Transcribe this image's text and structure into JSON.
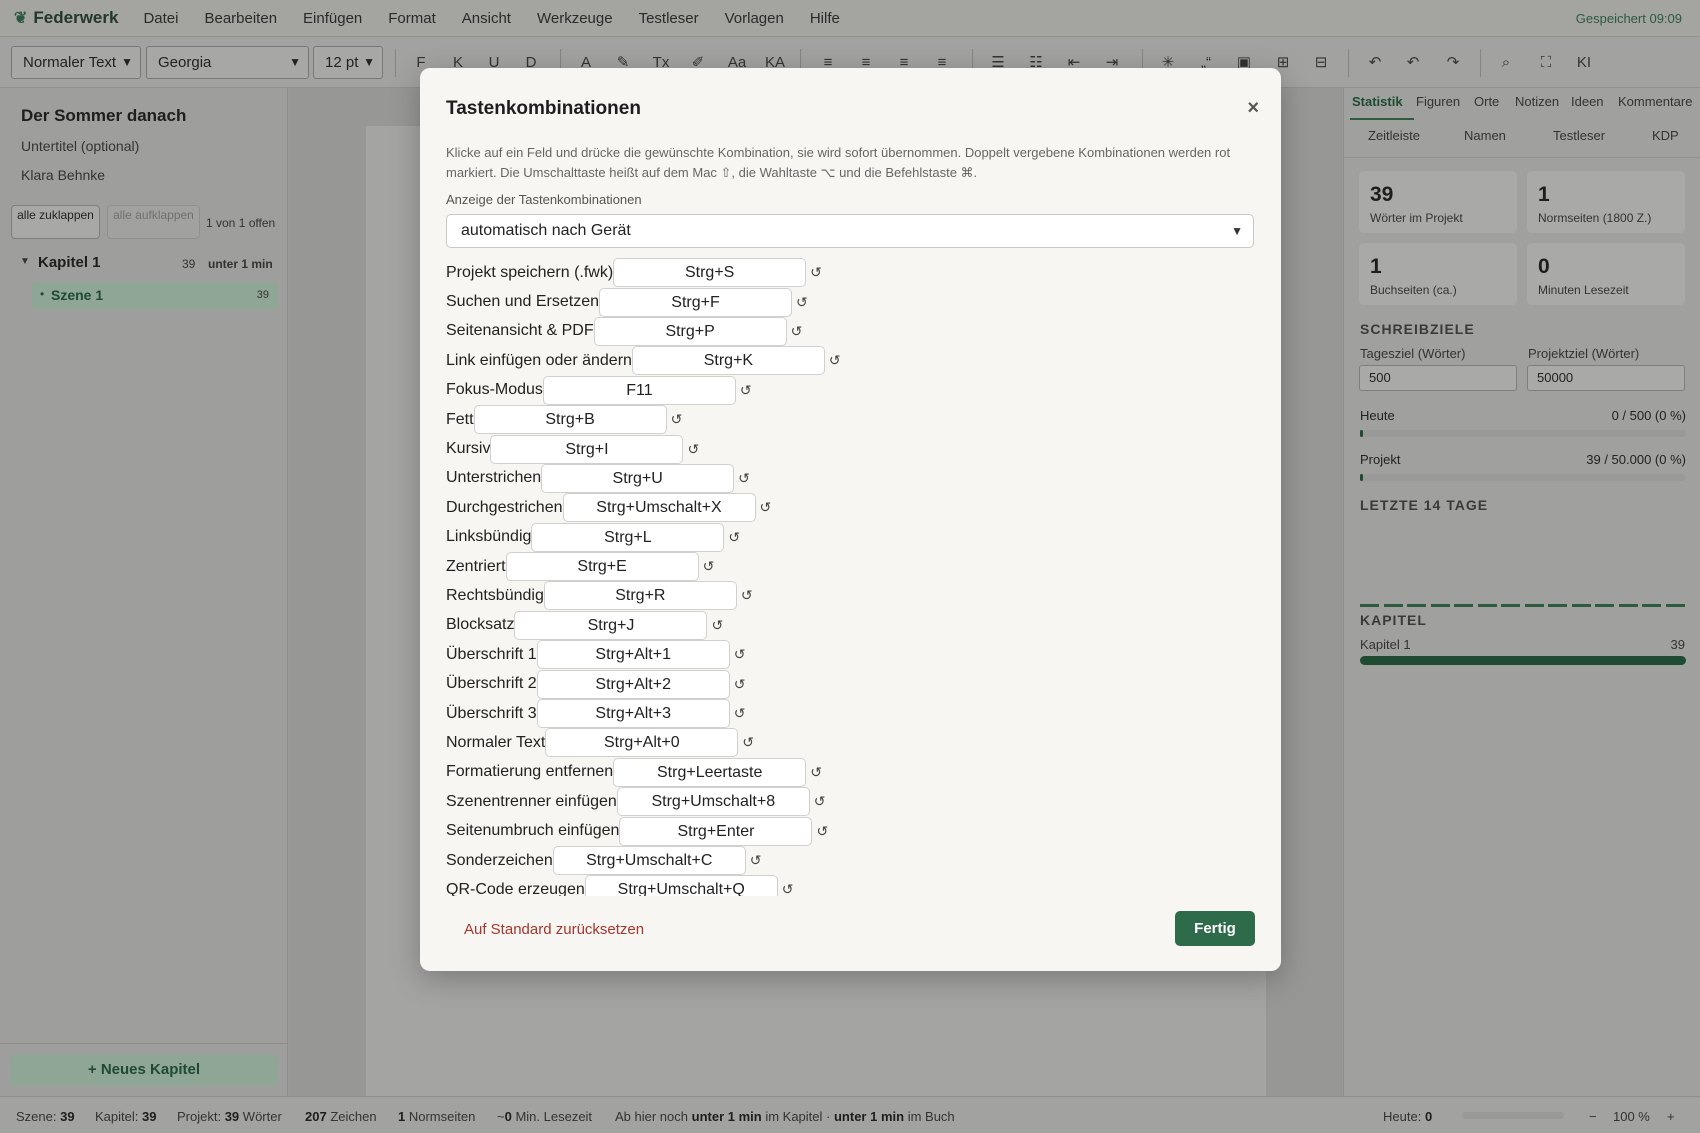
{
  "app": {
    "name": "Federwerk",
    "saved": "Gespeichert 09:09"
  },
  "menu": [
    "Datei",
    "Bearbeiten",
    "Einfügen",
    "Format",
    "Ansicht",
    "Werkzeuge",
    "Testleser",
    "Vorlagen",
    "Hilfe"
  ],
  "toolbar": {
    "style": "Normaler Text",
    "font": "Georgia",
    "size": "12 pt",
    "buttons": [
      {
        "name": "bold-button",
        "glyph": "F"
      },
      {
        "name": "italic-button",
        "glyph": "K"
      },
      {
        "name": "underline-button",
        "glyph": "U"
      },
      {
        "name": "strikethrough-button",
        "glyph": "D"
      },
      {
        "name": "text-color-button",
        "glyph": "A"
      },
      {
        "name": "highlight-button",
        "glyph": "✎"
      },
      {
        "name": "clear-format-button",
        "glyph": "Tx"
      },
      {
        "name": "pen-button",
        "glyph": "✐"
      },
      {
        "name": "case-button",
        "glyph": "Aa"
      },
      {
        "name": "small-caps-button",
        "glyph": "KA"
      },
      {
        "name": "align-left-button",
        "glyph": "≡"
      },
      {
        "name": "align-center-button",
        "glyph": "≡"
      },
      {
        "name": "align-right-button",
        "glyph": "≡"
      },
      {
        "name": "justify-button",
        "glyph": "≡"
      },
      {
        "name": "bullet-list-button",
        "glyph": "☰"
      },
      {
        "name": "numbered-list-button",
        "glyph": "☷"
      },
      {
        "name": "outdent-button",
        "glyph": "⇤"
      },
      {
        "name": "indent-button",
        "glyph": "⇥"
      },
      {
        "name": "special-char-button",
        "glyph": "✳"
      },
      {
        "name": "quote-button",
        "glyph": "„“"
      },
      {
        "name": "image-button",
        "glyph": "▣"
      },
      {
        "name": "table-button",
        "glyph": "⊞"
      },
      {
        "name": "page-break-button",
        "glyph": "⊟"
      },
      {
        "name": "undo-button",
        "glyph": "↶"
      },
      {
        "name": "undo-history-button",
        "glyph": "↶"
      },
      {
        "name": "redo-button",
        "glyph": "↷"
      },
      {
        "name": "search-button",
        "glyph": "⌕"
      },
      {
        "name": "fullscreen-button",
        "glyph": "⛶"
      },
      {
        "name": "ai-button",
        "glyph": "KI"
      }
    ]
  },
  "sidebar": {
    "title": "Der Sommer danach",
    "subtitle": "Untertitel (optional)",
    "author": "Klara Behnke",
    "collapse_all": "alle zuklappen",
    "expand_all": "alle aufklappen",
    "open_count": "1 von 1 offen",
    "chapter": {
      "name": "Kapitel 1",
      "words": "39",
      "time": "unter 1 min"
    },
    "scene": {
      "name": "Szene 1",
      "words": "39"
    },
    "new_chapter": "+ Neues Kapitel"
  },
  "right": {
    "tabs": [
      "Statistik",
      "Figuren",
      "Orte",
      "Notizen",
      "Ideen",
      "Kommentare"
    ],
    "tabs2": [
      "Zeitleiste",
      "Namen",
      "Testleser",
      "KDP"
    ],
    "stats": [
      {
        "num": "39",
        "label": "Wörter im Projekt"
      },
      {
        "num": "1",
        "label": "Normseiten (1800 Z.)"
      },
      {
        "num": "1",
        "label": "Buchseiten (ca.)"
      },
      {
        "num": "0",
        "label": "Minuten Lesezeit"
      }
    ],
    "goals_title": "SCHREIBZIELE",
    "daily_label": "Tagesziel (Wörter)",
    "project_label": "Projektziel (Wörter)",
    "daily_value": "500",
    "project_value": "50000",
    "today_label": "Heute",
    "today_value": "0 / 500 (0 %)",
    "today_fraction": 0.0,
    "project_prog_label": "Projekt",
    "project_prog_value": "39 / 50.000 (0 %)",
    "project_fraction": 0.0008,
    "last14_title": "LETZTE 14 TAGE",
    "chapters_title": "KAPITEL",
    "chapter_name": "Kapitel 1",
    "chapter_words": "39"
  },
  "status": {
    "scene_label": "Szene:",
    "scene": "39",
    "chapter_label": "Kapitel:",
    "chapter": "39",
    "project_label": "Projekt:",
    "project": "39",
    "words_suffix": "Wörter",
    "chars": "207",
    "chars_label": "Zeichen",
    "pages": "1",
    "pages_label": "Normseiten",
    "read_prefix": "~",
    "read": "0",
    "read_label": "Min. Lesezeit",
    "remain_prefix": "Ab hier noch",
    "remain1": "unter 1 min",
    "remain_mid": "im Kapitel ·",
    "remain2": "unter 1 min",
    "remain_suffix": "im Buch",
    "today_label": "Heute:",
    "today": "0",
    "zoom_minus": "−",
    "zoom": "100 %",
    "zoom_plus": "+"
  },
  "modal": {
    "title": "Tastenkombinationen",
    "close": "×",
    "description": "Klicke auf ein Feld und drücke die gewünschte Kombination, sie wird sofort übernommen. Doppelt vergebene Kombinationen werden rot markiert. Die Umschalttaste heißt auf dem Mac ⇧, die Wahltaste ⌥ und die Befehlstaste ⌘.",
    "display_label": "Anzeige der Tastenkombinationen",
    "display_value": "automatisch nach Gerät",
    "reset_all": "Auf Standard zurücksetzen",
    "done": "Fertig",
    "shortcuts": [
      {
        "label": "Projekt speichern (.fwk)",
        "key": "Strg+S"
      },
      {
        "label": "Suchen und Ersetzen",
        "key": "Strg+F"
      },
      {
        "label": "Seitenansicht & PDF",
        "key": "Strg+P"
      },
      {
        "label": "Link einfügen oder ändern",
        "key": "Strg+K"
      },
      {
        "label": "Fokus-Modus",
        "key": "F11"
      },
      {
        "label": "Fett",
        "key": "Strg+B"
      },
      {
        "label": "Kursiv",
        "key": "Strg+I"
      },
      {
        "label": "Unterstrichen",
        "key": "Strg+U"
      },
      {
        "label": "Durchgestrichen",
        "key": "Strg+Umschalt+X"
      },
      {
        "label": "Linksbündig",
        "key": "Strg+L"
      },
      {
        "label": "Zentriert",
        "key": "Strg+E"
      },
      {
        "label": "Rechtsbündig",
        "key": "Strg+R"
      },
      {
        "label": "Blocksatz",
        "key": "Strg+J"
      },
      {
        "label": "Überschrift 1",
        "key": "Strg+Alt+1"
      },
      {
        "label": "Überschrift 2",
        "key": "Strg+Alt+2"
      },
      {
        "label": "Überschrift 3",
        "key": "Strg+Alt+3"
      },
      {
        "label": "Normaler Text",
        "key": "Strg+Alt+0"
      },
      {
        "label": "Formatierung entfernen",
        "key": "Strg+Leertaste"
      },
      {
        "label": "Szenentrenner einfügen",
        "key": "Strg+Umschalt+8"
      },
      {
        "label": "Seitenumbruch einfügen",
        "key": "Strg+Enter"
      },
      {
        "label": "Sonderzeichen",
        "key": "Strg+Umschalt+C"
      },
      {
        "label": "QR-Code erzeugen",
        "key": "Strg+Umschalt+Q"
      }
    ]
  },
  "colors": {
    "accent": "#2e6b4a",
    "danger": "#a5372f"
  }
}
